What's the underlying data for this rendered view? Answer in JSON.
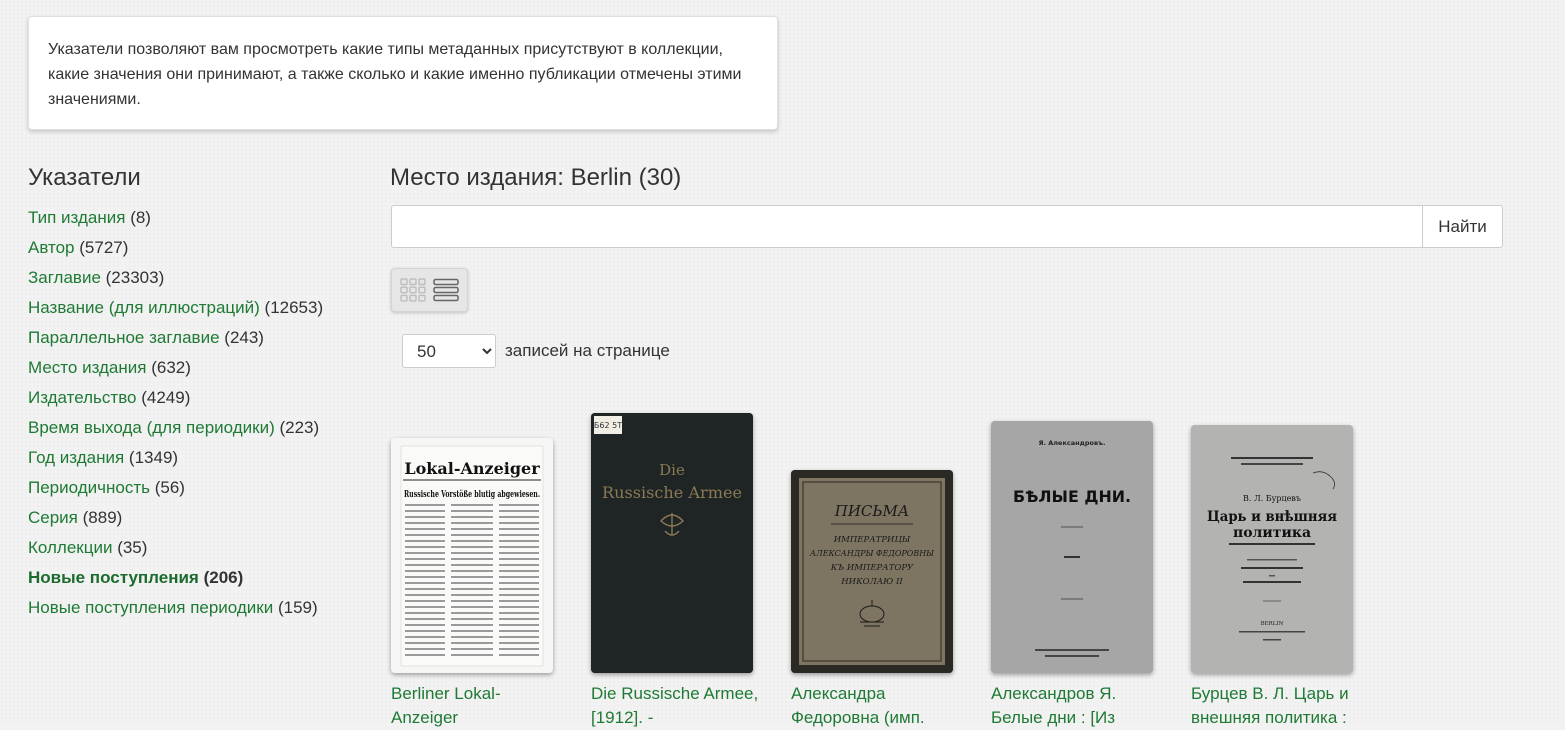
{
  "info": {
    "text": "Указатели позволяют вам просмотреть какие типы метаданных присутствуют в коллекции, какие значения они принимают, а также сколько и какие именно публикации отмечены этими значениями."
  },
  "sidebar": {
    "title": "Указатели",
    "items": [
      {
        "label": "Тип издания",
        "count": "(8)"
      },
      {
        "label": "Автор",
        "count": "(5727)"
      },
      {
        "label": "Заглавие",
        "count": "(23303)"
      },
      {
        "label": "Название (для иллюстраций)",
        "count": "(12653)"
      },
      {
        "label": "Параллельное заглавие",
        "count": "(243)"
      },
      {
        "label": "Место издания",
        "count": "(632)"
      },
      {
        "label": "Издательство",
        "count": "(4249)"
      },
      {
        "label": "Время выхода (для периодики)",
        "count": "(223)"
      },
      {
        "label": "Год издания",
        "count": "(1349)"
      },
      {
        "label": "Периодичность",
        "count": "(56)"
      },
      {
        "label": "Серия",
        "count": "(889)"
      },
      {
        "label": "Коллекции",
        "count": "(35)"
      },
      {
        "label": "Новые поступления",
        "count": "(206)"
      },
      {
        "label": "Новые поступления периодики",
        "count": "(159)"
      }
    ]
  },
  "main": {
    "title": "Место издания: Berlin (30)",
    "search": {
      "value": "",
      "placeholder": "",
      "button": "Найти"
    },
    "per_page": {
      "selected": "50",
      "label": "записей на странице"
    },
    "cards": [
      {
        "title": "Berliner Lokal-Anzeiger",
        "cover_text_1": "Lokal-Anzeiger",
        "cover_text_2": "Russische Vorstöße blutig abgewiesen."
      },
      {
        "title": "Die Russische Armee, [1912]. -",
        "cover_text_1": "Die",
        "cover_text_2": "Russische Armee",
        "stamp": "Б62 5Т"
      },
      {
        "title": "Александра Федоровна (имп.",
        "cover_text_1": "ПИСЬМА",
        "cover_text_2": "ИМПЕРАТРИЦЫ",
        "cover_text_3": "АЛЕКСАНДРЫ ФЕДОРОВНЫ",
        "cover_text_4": "КЪ ИМПЕРАТОРУ",
        "cover_text_5": "НИКОЛАЮ II"
      },
      {
        "title": "Александров Я. Белые дни : [Из",
        "cover_text_1": "Я. Александровъ.",
        "cover_text_2": "БѢЛЫЕ ДНИ."
      },
      {
        "title": "Бурцев В. Л. Царь и внешняя политика :",
        "cover_text_1": "В. Л. Бурцевъ",
        "cover_text_2": "Царь и внѣшняя",
        "cover_text_3": "политика",
        "cover_text_4": "BERLIN"
      }
    ]
  }
}
